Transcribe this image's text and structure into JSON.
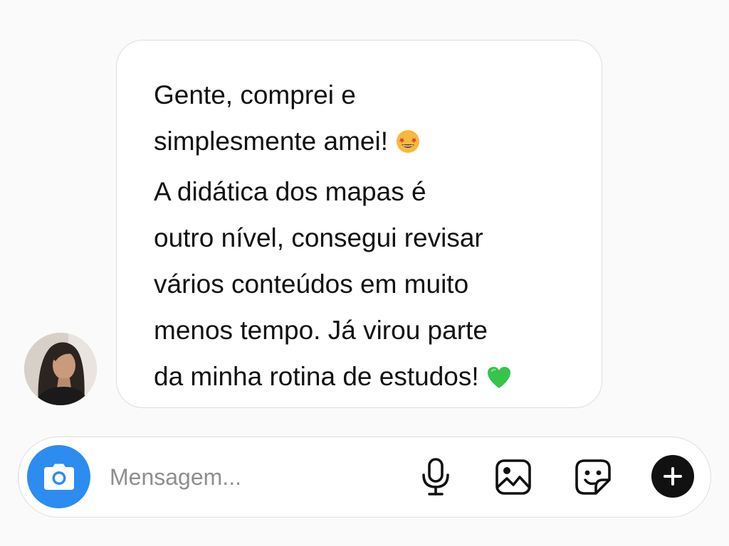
{
  "message": {
    "lines": [
      "Gente, comprei e",
      "simplesmente amei!",
      "A didática dos mapas é",
      "outro nível, consegui revisar",
      "vários conteúdos em muito",
      "menos tempo. Já virou parte",
      "da minha rotina de estudos!"
    ],
    "emojis": [
      "star-struck-emoji",
      "green-heart-emoji"
    ]
  },
  "composer": {
    "placeholder": "Mensagem...",
    "icons": [
      "camera-icon",
      "microphone-icon",
      "gallery-icon",
      "sticker-icon",
      "plus-icon"
    ]
  },
  "colors": {
    "background": "#fafafa",
    "bubble": "#ffffff",
    "border": "#dedede",
    "camera_button": "#2d8cf0",
    "plus_button": "#111111",
    "text": "#111111",
    "placeholder": "#8e8e8e"
  }
}
